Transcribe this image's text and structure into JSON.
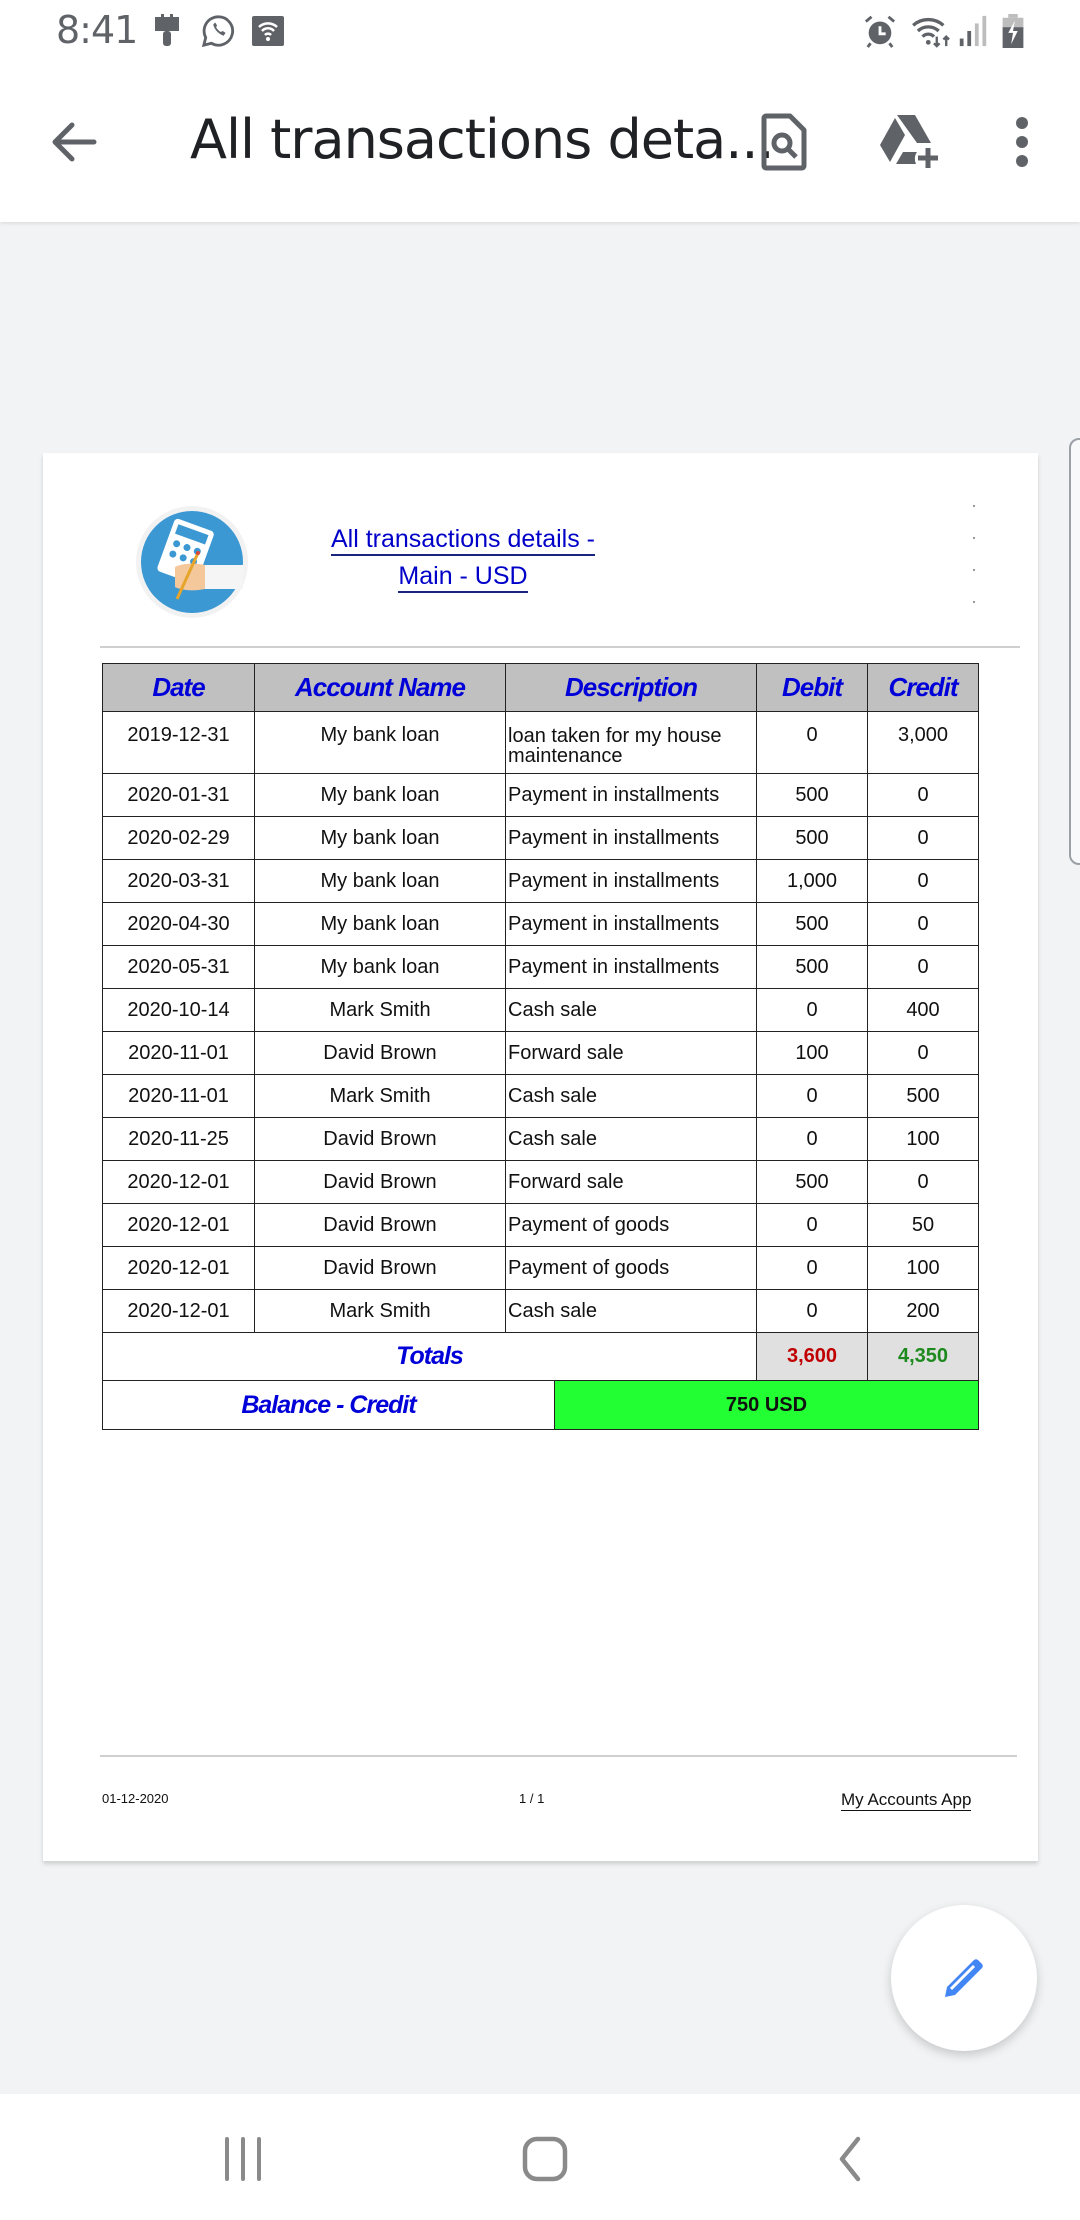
{
  "status_bar": {
    "time": "8:41",
    "left_icons": [
      "paintbrush-icon",
      "whatsapp-icon",
      "wifi-hotspot-icon"
    ],
    "right_icons": [
      "alarm-icon",
      "wifi-data-icon",
      "signal-icon",
      "battery-charging-icon"
    ]
  },
  "app_bar": {
    "title": "All transactions deta...",
    "back_icon": "arrow-back-icon",
    "actions": [
      "find-in-page-icon",
      "add-to-drive-icon",
      "more-vert-icon"
    ]
  },
  "document": {
    "title_line1": "All transactions details -",
    "title_line2": "Main - USD",
    "logo": "calculator-hand-logo",
    "table": {
      "headers": [
        "Date",
        "Account Name",
        "Description",
        "Debit",
        "Credit"
      ],
      "rows": [
        {
          "date": "2019-12-31",
          "account": "My bank loan",
          "description": "loan taken for my house maintenance",
          "debit": "0",
          "credit": "3,000"
        },
        {
          "date": "2020-01-31",
          "account": "My bank loan",
          "description": "Payment in installments",
          "debit": "500",
          "credit": "0"
        },
        {
          "date": "2020-02-29",
          "account": "My bank loan",
          "description": "Payment in installments",
          "debit": "500",
          "credit": "0"
        },
        {
          "date": "2020-03-31",
          "account": "My bank loan",
          "description": "Payment in installments",
          "debit": "1,000",
          "credit": "0"
        },
        {
          "date": "2020-04-30",
          "account": "My bank loan",
          "description": "Payment in installments",
          "debit": "500",
          "credit": "0"
        },
        {
          "date": "2020-05-31",
          "account": "My bank loan",
          "description": "Payment in installments",
          "debit": "500",
          "credit": "0"
        },
        {
          "date": "2020-10-14",
          "account": "Mark Smith",
          "description": "Cash sale",
          "debit": "0",
          "credit": "400"
        },
        {
          "date": "2020-11-01",
          "account": "David Brown",
          "description": "Forward sale",
          "debit": "100",
          "credit": "0"
        },
        {
          "date": "2020-11-01",
          "account": "Mark Smith",
          "description": "Cash sale",
          "debit": "0",
          "credit": "500"
        },
        {
          "date": "2020-11-25",
          "account": "David Brown",
          "description": "Cash sale",
          "debit": "0",
          "credit": "100"
        },
        {
          "date": "2020-12-01",
          "account": "David Brown",
          "description": "Forward sale",
          "debit": "500",
          "credit": "0"
        },
        {
          "date": "2020-12-01",
          "account": "David Brown",
          "description": "Payment of goods",
          "debit": "0",
          "credit": "50"
        },
        {
          "date": "2020-12-01",
          "account": "David Brown",
          "description": "Payment of goods",
          "debit": "0",
          "credit": "100"
        },
        {
          "date": "2020-12-01",
          "account": "Mark Smith",
          "description": "Cash sale",
          "debit": "0",
          "credit": "200"
        }
      ],
      "totals_label": "Totals",
      "total_debit": "3,600",
      "total_credit": "4,350",
      "balance_label": "Balance - Credit",
      "balance_value": "750 USD"
    },
    "footer": {
      "date": "01-12-2020",
      "page": "1 / 1",
      "app_name": "My Accounts App"
    }
  },
  "colors": {
    "header_text": "#0000d8",
    "header_bg": "#c0c0c0",
    "total_debit": "#c00000",
    "total_credit": "#1e8a1e",
    "balance_bg": "#22ff33",
    "fab_icon": "#4285f4"
  },
  "fab": {
    "icon": "edit-pencil-icon"
  },
  "nav_bar": {
    "buttons": [
      "recent-apps-icon",
      "home-icon",
      "back-icon"
    ]
  }
}
